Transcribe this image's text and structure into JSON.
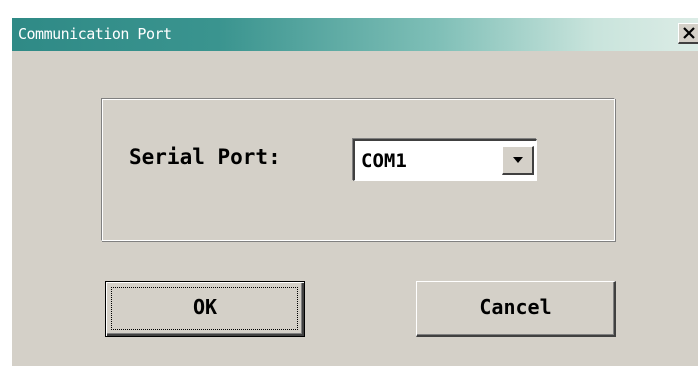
{
  "dialog": {
    "title": "Communication Port",
    "close_icon": "close-icon"
  },
  "serial_port": {
    "label": "Serial Port:",
    "selected_value": "COM1",
    "dropdown_icon": "chevron-down-icon"
  },
  "buttons": {
    "ok_label": "OK",
    "cancel_label": "Cancel"
  },
  "colors": {
    "title_gradient_start": "#2f8a86",
    "title_gradient_end": "#dcece6",
    "dialog_background": "#d4d0c8"
  }
}
